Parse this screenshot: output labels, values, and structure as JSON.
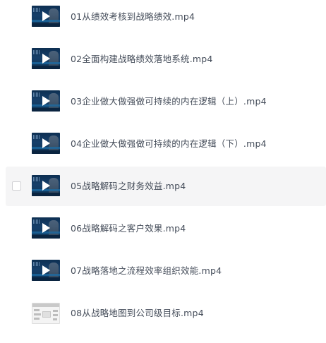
{
  "files": [
    {
      "name": "01从绩效考核到战略绩效.mp4",
      "thumb": "video-thumbnail"
    },
    {
      "name": "02全面构建战略绩效落地系统.mp4",
      "thumb": "video-thumbnail"
    },
    {
      "name": "03企业做大做强做可持续的内在逻辑（上）.mp4",
      "thumb": "video-thumbnail"
    },
    {
      "name": "04企业做大做强做可持续的内在逻辑（下）.mp4",
      "thumb": "video-thumbnail"
    },
    {
      "name": "05战略解码之财务效益.mp4",
      "thumb": "video-thumbnail",
      "hovered": true
    },
    {
      "name": "06战略解码之客户效果.mp4",
      "thumb": "video-thumbnail"
    },
    {
      "name": "07战略落地之流程效率组织效能.mp4",
      "thumb": "video-thumbnail"
    },
    {
      "name": "08从战略地图到公司级目标.mp4",
      "thumb": "document-thumbnail"
    }
  ],
  "colors": {
    "text": "#454d5a",
    "hover_bg": "#f5f5f6",
    "video_thumb": "#0d2f52"
  }
}
